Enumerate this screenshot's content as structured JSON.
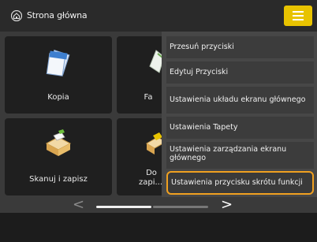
{
  "header": {
    "title": "Strona główna",
    "home_icon": "home-icon",
    "menu_icon": "hamburger-menu-icon",
    "accent": "#e8c300"
  },
  "tiles": [
    {
      "label": "Kopia",
      "icon": "copy-icon"
    },
    {
      "label": "Fa",
      "icon": "fax-icon"
    },
    {
      "label": "Skanuj i zapisz",
      "icon": "scan-and-store-icon"
    },
    {
      "label_line1": "Do",
      "label_line2": "zapi...",
      "icon": "store-icon"
    }
  ],
  "menu": {
    "items": [
      {
        "label": "Przesuń przyciski"
      },
      {
        "label": "Edytuj Przyciski"
      },
      {
        "label": "Ustawienia układu ekranu głównego"
      },
      {
        "label": "Ustawienia Tapety"
      },
      {
        "label_line1": "Ustawienia zarządzania ekranu",
        "label_line2": "głównego"
      },
      {
        "label": "Ustawienia przycisku skrótu funkcji"
      }
    ],
    "highlight_color": "#f0a020"
  },
  "pager": {
    "prev": "<",
    "next": ">"
  }
}
